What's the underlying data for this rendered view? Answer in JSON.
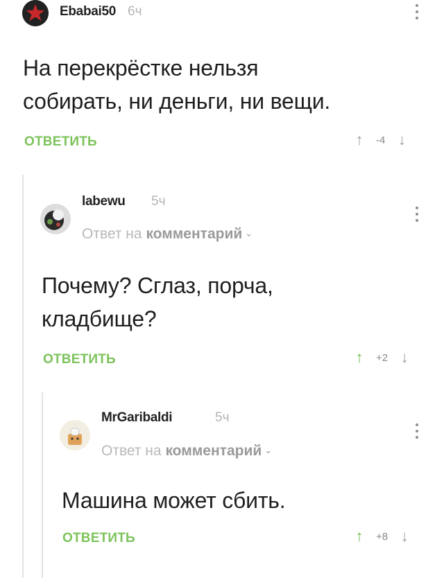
{
  "comments": [
    {
      "author": "Ebabai50",
      "time": "6ч",
      "text_lines": [
        "На перекрёстке нельзя",
        "собирать, ни деньги, ни вещи."
      ],
      "reply_label": "ОТВЕТИТЬ",
      "score": "-4",
      "avatar_icon": "red-star-avatar-icon"
    },
    {
      "author": "labewu",
      "time": "5ч",
      "reply_to_prefix": "Ответ на",
      "reply_to_link": "комментарий",
      "text_lines": [
        "Почему? Сглаз, порча,",
        "кладбище?"
      ],
      "reply_label": "ОТВЕТИТЬ",
      "score": "+2",
      "avatar_icon": "user-photo-avatar-icon"
    },
    {
      "author": "MrGaribaldi",
      "time": "5ч",
      "reply_to_prefix": "Ответ на",
      "reply_to_link": "комментарий",
      "text_lines": [
        "Машина может сбить."
      ],
      "reply_label": "ОТВЕТИТЬ",
      "score": "+8",
      "avatar_icon": "cartoon-avatar-icon"
    }
  ],
  "colors": {
    "accent_green": "#7cc35b",
    "upvote_green": "#6cb94a",
    "muted_gray": "#b5b5b5"
  }
}
